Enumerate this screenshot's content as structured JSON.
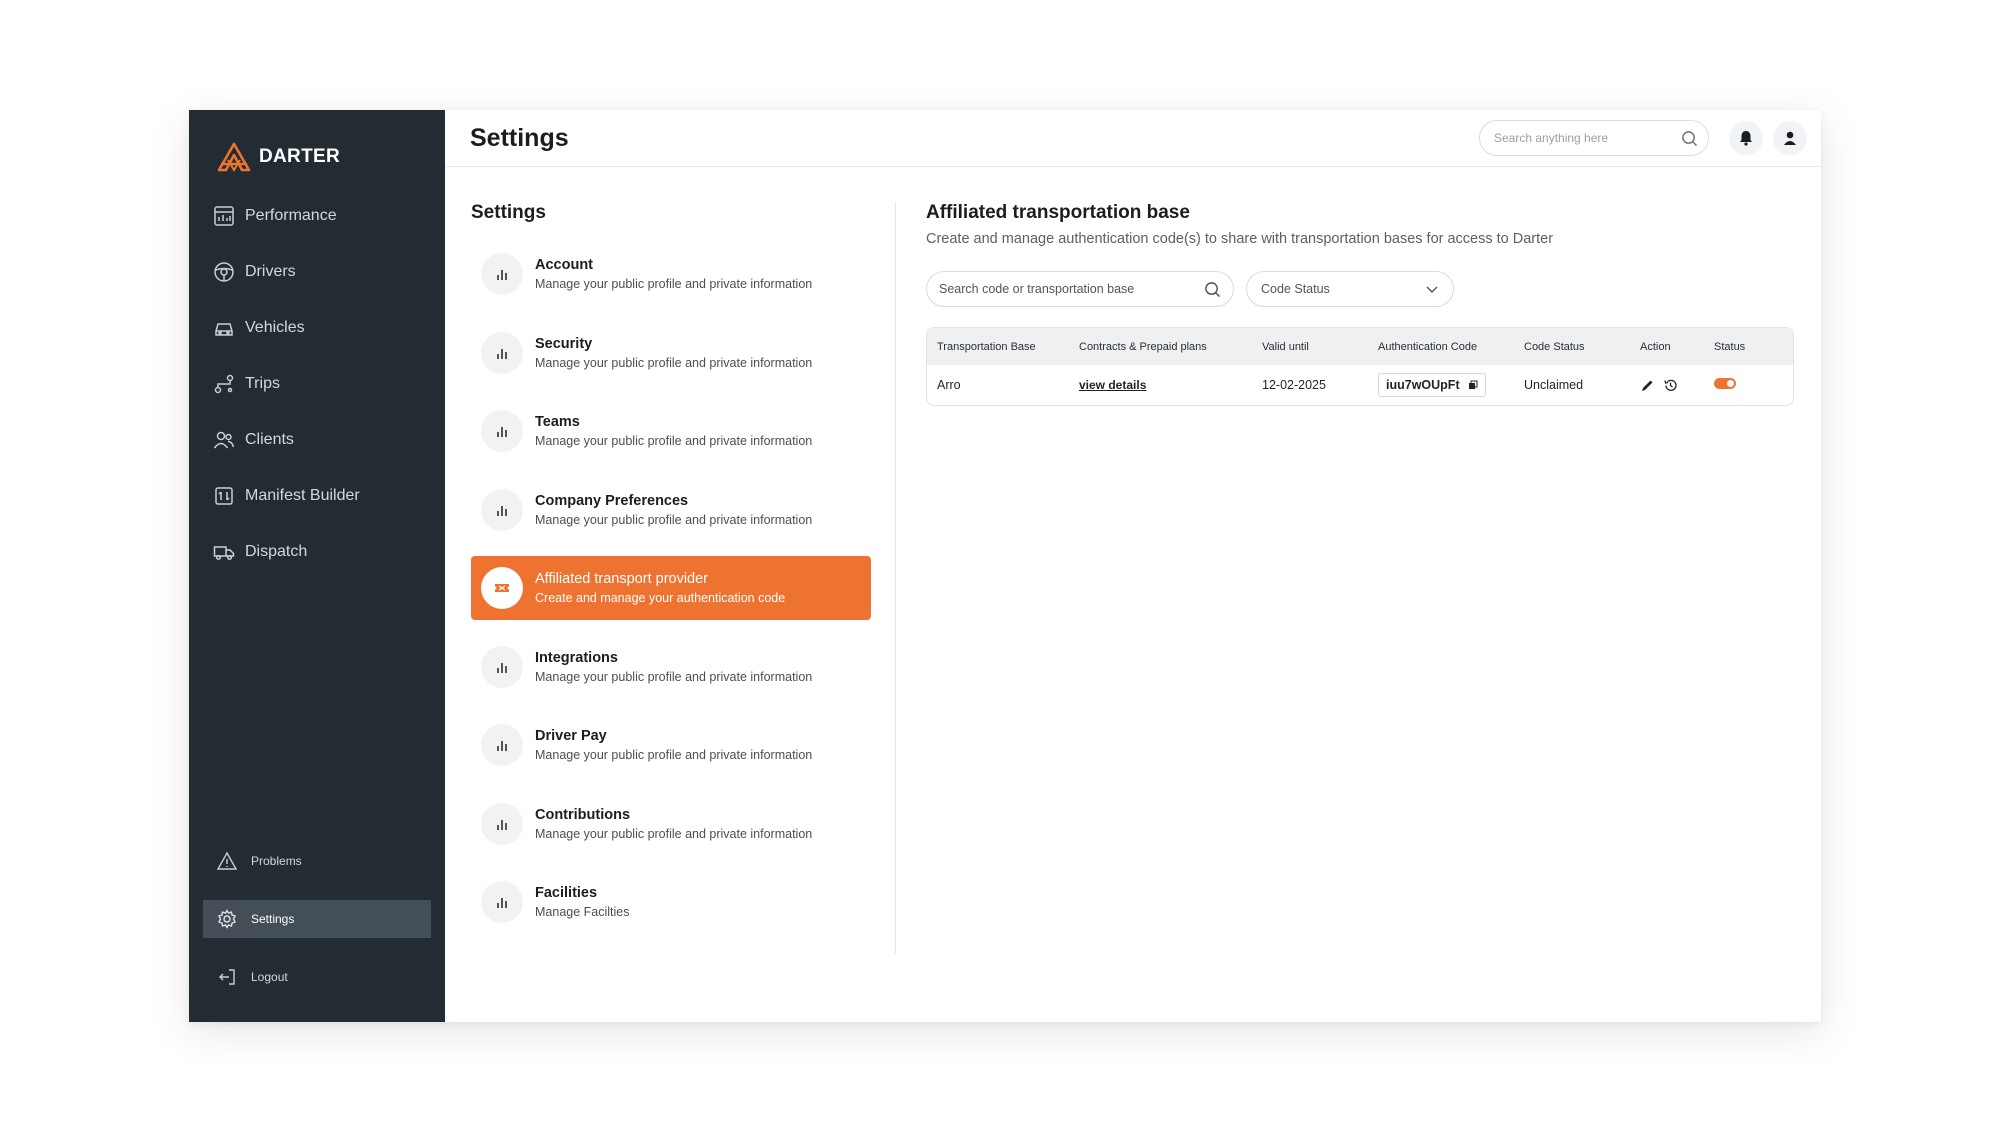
{
  "brand": {
    "name": "DARTER",
    "accent": "#ee7330",
    "sidebar_bg": "#232c33"
  },
  "header": {
    "title": "Settings",
    "search_placeholder": "Search anything here"
  },
  "sidebar": {
    "nav": [
      {
        "label": "Performance",
        "icon": "chart-icon"
      },
      {
        "label": "Drivers",
        "icon": "steering-wheel-icon"
      },
      {
        "label": "Vehicles",
        "icon": "car-icon"
      },
      {
        "label": "Trips",
        "icon": "route-icon"
      },
      {
        "label": "Clients",
        "icon": "users-icon"
      },
      {
        "label": "Manifest Builder",
        "icon": "manifest-icon"
      },
      {
        "label": "Dispatch",
        "icon": "truck-icon"
      }
    ],
    "bottom": [
      {
        "label": "Problems",
        "icon": "warning-icon"
      },
      {
        "label": "Settings",
        "icon": "gear-icon",
        "active": true
      },
      {
        "label": "Logout",
        "icon": "logout-icon"
      }
    ]
  },
  "settings": {
    "heading": "Settings",
    "items": [
      {
        "title": "Account",
        "desc": "Manage your public profile and private information"
      },
      {
        "title": "Security",
        "desc": "Manage your public profile and private information"
      },
      {
        "title": "Teams",
        "desc": "Manage your public profile and private information"
      },
      {
        "title": "Company Preferences",
        "desc": "Manage your public profile and private information"
      },
      {
        "title": "Affiliated transport provider",
        "desc": "Create and manage your authentication code",
        "active": true
      },
      {
        "title": "Integrations",
        "desc": "Manage your public profile and private information"
      },
      {
        "title": "Driver Pay",
        "desc": "Manage your public profile and private information"
      },
      {
        "title": "Contributions",
        "desc": "Manage your public profile and private information"
      },
      {
        "title": "Facilities",
        "desc": "Manage Facilties"
      }
    ]
  },
  "panel": {
    "title": "Affiliated transportation base",
    "subtitle": "Create and manage authentication code(s) to share with transportation bases for access to Darter",
    "search_placeholder": "Search code or transportation base",
    "status_filter": "Code Status",
    "table": {
      "columns": [
        "Transportation Base",
        "Contracts & Prepaid plans",
        "Valid until",
        "Authentication Code",
        "Code Status",
        "Action",
        "Status"
      ],
      "rows": [
        {
          "base": "Arro",
          "contracts": "view details",
          "valid_until": "12-02-2025",
          "code": "iuu7wOUpFt",
          "code_status": "Unclaimed",
          "status_on": true
        }
      ]
    }
  }
}
